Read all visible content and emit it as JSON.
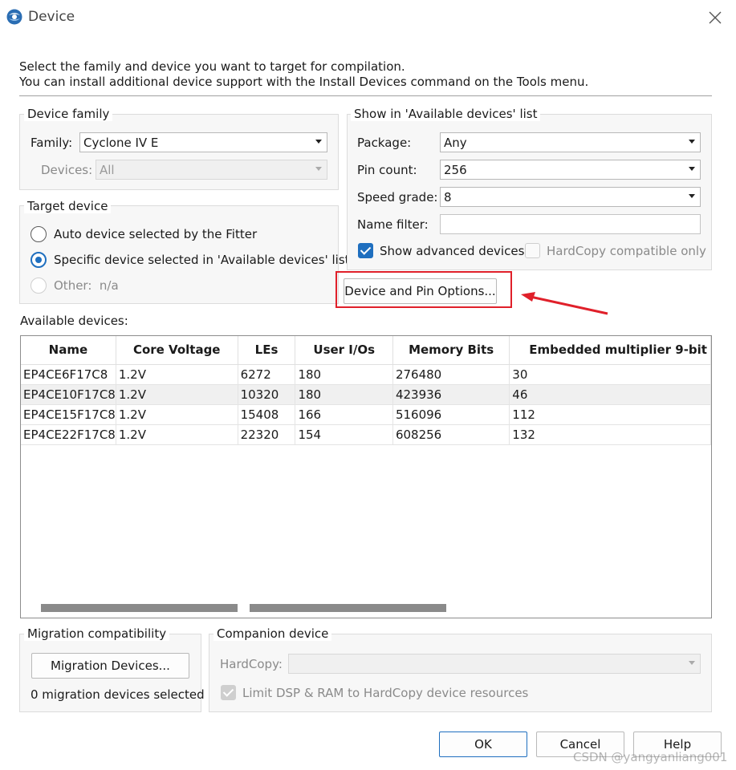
{
  "window": {
    "title": "Device"
  },
  "intro": {
    "line1": "Select the family and device you want to target for compilation.",
    "line2": "You can install additional device support with the Install Devices command on the Tools menu."
  },
  "device_family": {
    "legend": "Device family",
    "family_label": "Family:",
    "family_value": "Cyclone IV E",
    "devices_label": "Devices:",
    "devices_value": "All"
  },
  "target_device": {
    "legend": "Target device",
    "options": [
      {
        "label": "Auto device selected by the Fitter",
        "selected": false,
        "enabled": true
      },
      {
        "label": "Specific device selected in 'Available devices' list",
        "selected": true,
        "enabled": true
      },
      {
        "label": "Other:  n/a",
        "selected": false,
        "enabled": false
      }
    ]
  },
  "show_in_list": {
    "legend": "Show in 'Available devices' list",
    "package_label": "Package:",
    "package_value": "Any",
    "pin_count_label": "Pin count:",
    "pin_count_value": "256",
    "speed_grade_label": "Speed grade:",
    "speed_grade_value": "8",
    "name_filter_label": "Name filter:",
    "name_filter_value": "",
    "show_advanced_label": "Show advanced devices",
    "show_advanced_checked": true,
    "hardcopy_only_label": "HardCopy compatible only",
    "hardcopy_only_checked": false
  },
  "device_pin_options_button": "Device and Pin Options...",
  "available_devices": {
    "label": "Available devices:",
    "columns": [
      "Name",
      "Core Voltage",
      "LEs",
      "User I/Os",
      "Memory Bits",
      "Embedded multiplier 9-bit"
    ],
    "rows": [
      [
        "EP4CE6F17C8",
        "1.2V",
        "6272",
        "180",
        "276480",
        "30"
      ],
      [
        "EP4CE10F17C8",
        "1.2V",
        "10320",
        "180",
        "423936",
        "46"
      ],
      [
        "EP4CE15F17C8",
        "1.2V",
        "15408",
        "166",
        "516096",
        "112"
      ],
      [
        "EP4CE22F17C8",
        "1.2V",
        "22320",
        "154",
        "608256",
        "132"
      ]
    ]
  },
  "migration": {
    "legend": "Migration compatibility",
    "button": "Migration Devices...",
    "status": "0 migration devices selected"
  },
  "companion": {
    "legend": "Companion device",
    "hardcopy_label": "HardCopy:",
    "hardcopy_value": "",
    "limit_label": "Limit DSP & RAM to HardCopy device resources",
    "limit_checked": true
  },
  "footer": {
    "ok": "OK",
    "cancel": "Cancel",
    "help": "Help"
  },
  "watermark": "CSDN @yangyanliang001",
  "colors": {
    "accent": "#1f6fbf",
    "annotation": "#e0202a"
  }
}
